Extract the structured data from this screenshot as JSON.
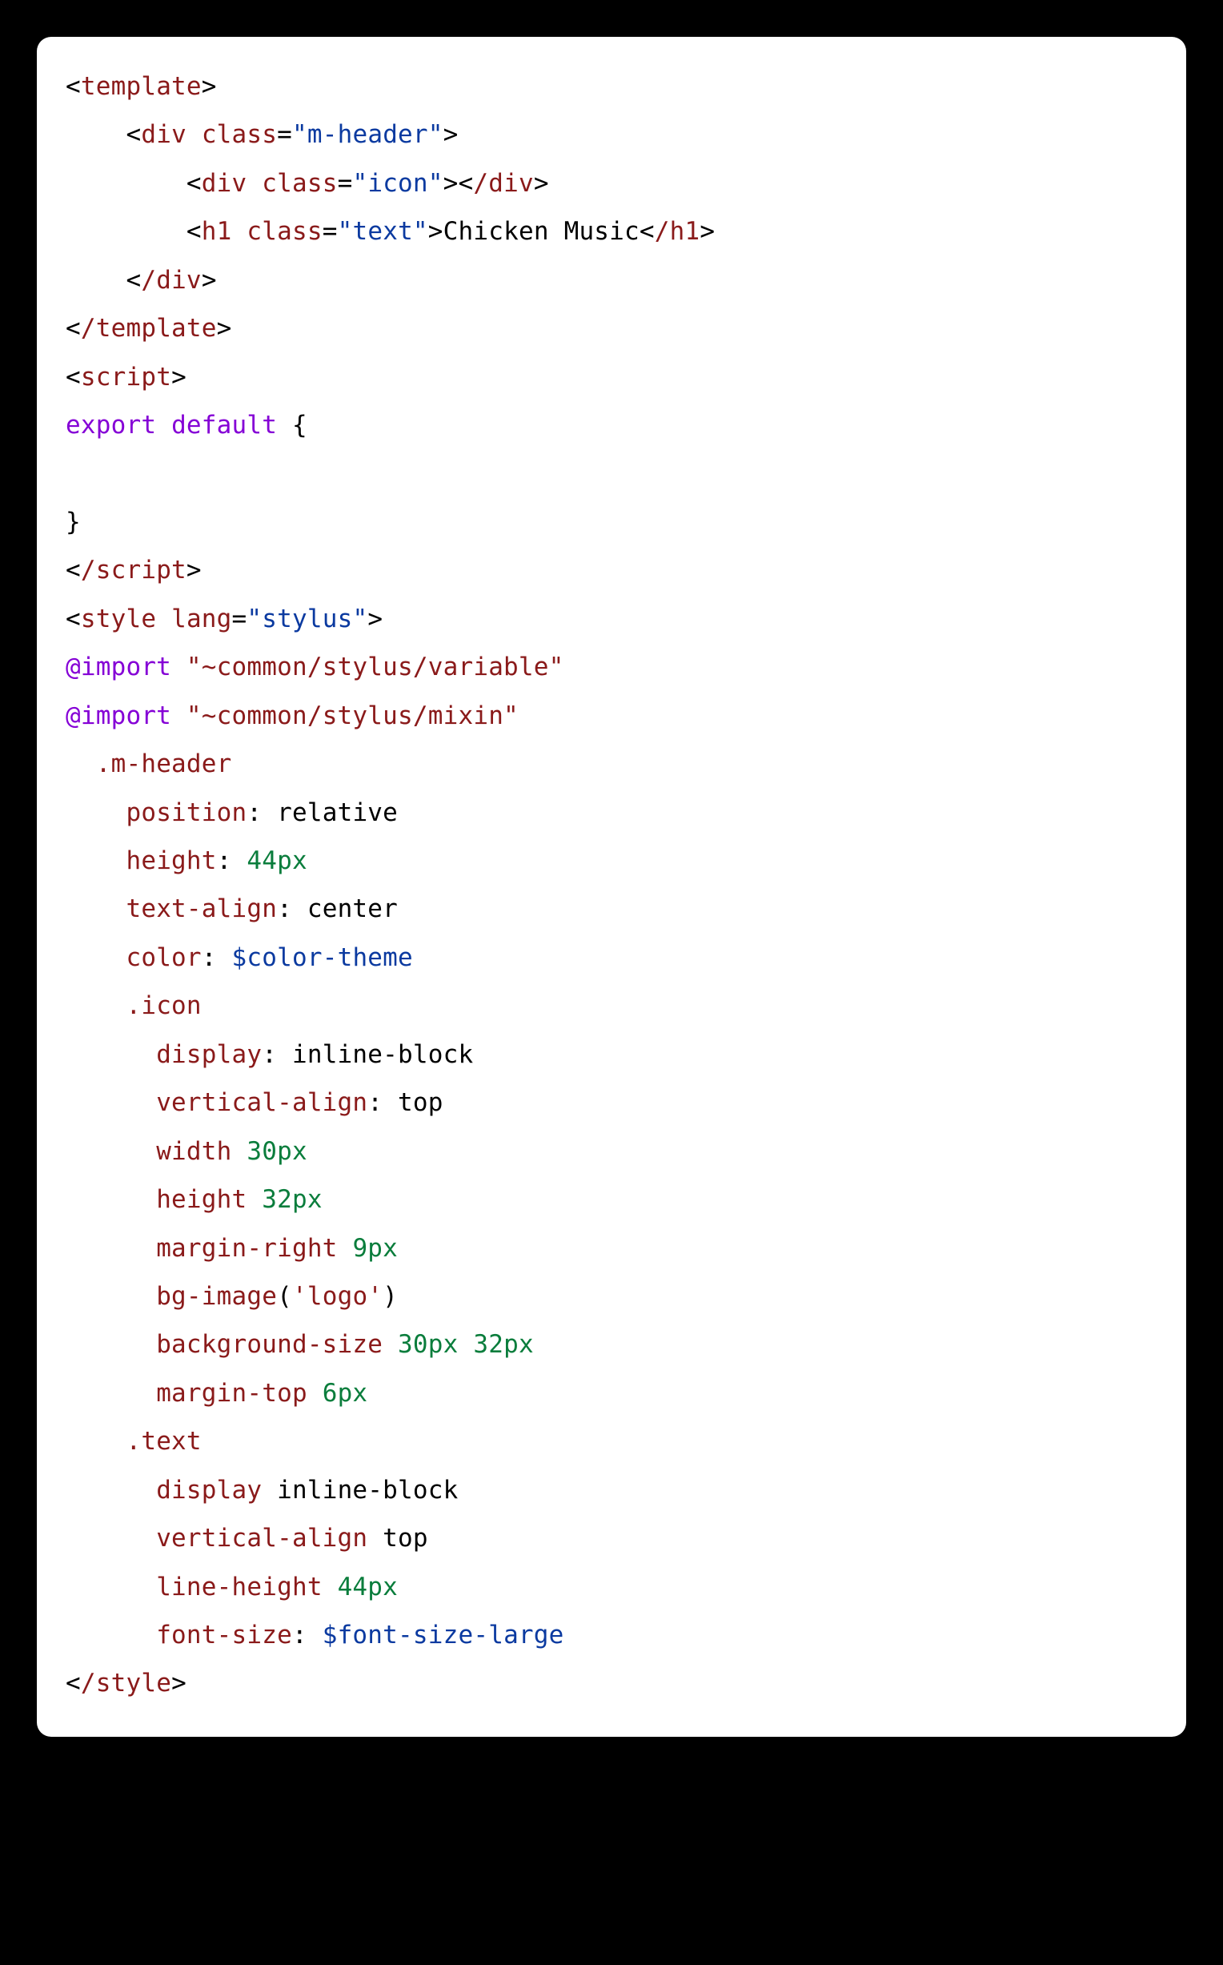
{
  "tokens": [
    {
      "t": "<",
      "c": "t-black"
    },
    {
      "t": "template",
      "c": "t-maroon"
    },
    {
      "t": ">",
      "c": "t-black"
    },
    {
      "t": "\n",
      "c": ""
    },
    {
      "t": "    ",
      "c": ""
    },
    {
      "t": "<",
      "c": "t-black"
    },
    {
      "t": "div",
      "c": "t-maroon"
    },
    {
      "t": " ",
      "c": ""
    },
    {
      "t": "class",
      "c": "t-maroon"
    },
    {
      "t": "=",
      "c": "t-black"
    },
    {
      "t": "\"m-header\"",
      "c": "t-blue"
    },
    {
      "t": ">",
      "c": "t-black"
    },
    {
      "t": "\n",
      "c": ""
    },
    {
      "t": "        ",
      "c": ""
    },
    {
      "t": "<",
      "c": "t-black"
    },
    {
      "t": "div",
      "c": "t-maroon"
    },
    {
      "t": " ",
      "c": ""
    },
    {
      "t": "class",
      "c": "t-maroon"
    },
    {
      "t": "=",
      "c": "t-black"
    },
    {
      "t": "\"icon\"",
      "c": "t-blue"
    },
    {
      "t": ">",
      "c": "t-black"
    },
    {
      "t": "<",
      "c": "t-black"
    },
    {
      "t": "/div",
      "c": "t-maroon"
    },
    {
      "t": ">",
      "c": "t-black"
    },
    {
      "t": "\n",
      "c": ""
    },
    {
      "t": "        ",
      "c": ""
    },
    {
      "t": "<",
      "c": "t-black"
    },
    {
      "t": "h1",
      "c": "t-maroon"
    },
    {
      "t": " ",
      "c": ""
    },
    {
      "t": "class",
      "c": "t-maroon"
    },
    {
      "t": "=",
      "c": "t-black"
    },
    {
      "t": "\"text\"",
      "c": "t-blue"
    },
    {
      "t": ">",
      "c": "t-black"
    },
    {
      "t": "Chicken Music",
      "c": "t-black"
    },
    {
      "t": "<",
      "c": "t-black"
    },
    {
      "t": "/h1",
      "c": "t-maroon"
    },
    {
      "t": ">",
      "c": "t-black"
    },
    {
      "t": "\n",
      "c": ""
    },
    {
      "t": "    ",
      "c": ""
    },
    {
      "t": "<",
      "c": "t-black"
    },
    {
      "t": "/div",
      "c": "t-maroon"
    },
    {
      "t": ">",
      "c": "t-black"
    },
    {
      "t": "\n",
      "c": ""
    },
    {
      "t": "<",
      "c": "t-black"
    },
    {
      "t": "/template",
      "c": "t-maroon"
    },
    {
      "t": ">",
      "c": "t-black"
    },
    {
      "t": "\n",
      "c": ""
    },
    {
      "t": "<",
      "c": "t-black"
    },
    {
      "t": "script",
      "c": "t-maroon"
    },
    {
      "t": ">",
      "c": "t-black"
    },
    {
      "t": "\n",
      "c": ""
    },
    {
      "t": "export",
      "c": "t-purple"
    },
    {
      "t": " ",
      "c": ""
    },
    {
      "t": "default",
      "c": "t-purple"
    },
    {
      "t": " {",
      "c": "t-black"
    },
    {
      "t": "\n",
      "c": ""
    },
    {
      "t": "\n",
      "c": ""
    },
    {
      "t": "}",
      "c": "t-black"
    },
    {
      "t": "\n",
      "c": ""
    },
    {
      "t": "<",
      "c": "t-black"
    },
    {
      "t": "/script",
      "c": "t-maroon"
    },
    {
      "t": ">",
      "c": "t-black"
    },
    {
      "t": "\n",
      "c": ""
    },
    {
      "t": "<",
      "c": "t-black"
    },
    {
      "t": "style",
      "c": "t-maroon"
    },
    {
      "t": " ",
      "c": ""
    },
    {
      "t": "lang",
      "c": "t-maroon"
    },
    {
      "t": "=",
      "c": "t-black"
    },
    {
      "t": "\"stylus\"",
      "c": "t-blue"
    },
    {
      "t": ">",
      "c": "t-black"
    },
    {
      "t": "\n",
      "c": ""
    },
    {
      "t": "@import",
      "c": "t-purple"
    },
    {
      "t": " ",
      "c": ""
    },
    {
      "t": "\"~common/stylus/variable\"",
      "c": "t-maroon"
    },
    {
      "t": "\n",
      "c": ""
    },
    {
      "t": "@import",
      "c": "t-purple"
    },
    {
      "t": " ",
      "c": ""
    },
    {
      "t": "\"~common/stylus/mixin\"",
      "c": "t-maroon"
    },
    {
      "t": "\n",
      "c": ""
    },
    {
      "t": "  ",
      "c": ""
    },
    {
      "t": ".m-header",
      "c": "t-maroon"
    },
    {
      "t": "\n",
      "c": ""
    },
    {
      "t": "    ",
      "c": ""
    },
    {
      "t": "position",
      "c": "t-maroon"
    },
    {
      "t": ": ",
      "c": "t-black"
    },
    {
      "t": "relative",
      "c": "t-black"
    },
    {
      "t": "\n",
      "c": ""
    },
    {
      "t": "    ",
      "c": ""
    },
    {
      "t": "height",
      "c": "t-maroon"
    },
    {
      "t": ": ",
      "c": "t-black"
    },
    {
      "t": "44px",
      "c": "t-green"
    },
    {
      "t": "\n",
      "c": ""
    },
    {
      "t": "    ",
      "c": ""
    },
    {
      "t": "text-align",
      "c": "t-maroon"
    },
    {
      "t": ": ",
      "c": "t-black"
    },
    {
      "t": "center",
      "c": "t-black"
    },
    {
      "t": "\n",
      "c": ""
    },
    {
      "t": "    ",
      "c": ""
    },
    {
      "t": "color",
      "c": "t-maroon"
    },
    {
      "t": ": ",
      "c": "t-black"
    },
    {
      "t": "$color-theme",
      "c": "t-blue"
    },
    {
      "t": "\n",
      "c": ""
    },
    {
      "t": "    ",
      "c": ""
    },
    {
      "t": ".icon",
      "c": "t-maroon"
    },
    {
      "t": "\n",
      "c": ""
    },
    {
      "t": "      ",
      "c": ""
    },
    {
      "t": "display",
      "c": "t-maroon"
    },
    {
      "t": ": ",
      "c": "t-black"
    },
    {
      "t": "inline-block",
      "c": "t-black"
    },
    {
      "t": "\n",
      "c": ""
    },
    {
      "t": "      ",
      "c": ""
    },
    {
      "t": "vertical-align",
      "c": "t-maroon"
    },
    {
      "t": ": ",
      "c": "t-black"
    },
    {
      "t": "top",
      "c": "t-black"
    },
    {
      "t": "\n",
      "c": ""
    },
    {
      "t": "      ",
      "c": ""
    },
    {
      "t": "width",
      "c": "t-maroon"
    },
    {
      "t": " ",
      "c": ""
    },
    {
      "t": "30px",
      "c": "t-green"
    },
    {
      "t": "\n",
      "c": ""
    },
    {
      "t": "      ",
      "c": ""
    },
    {
      "t": "height",
      "c": "t-maroon"
    },
    {
      "t": " ",
      "c": ""
    },
    {
      "t": "32px",
      "c": "t-green"
    },
    {
      "t": "\n",
      "c": ""
    },
    {
      "t": "      ",
      "c": ""
    },
    {
      "t": "margin-right",
      "c": "t-maroon"
    },
    {
      "t": " ",
      "c": ""
    },
    {
      "t": "9px",
      "c": "t-green"
    },
    {
      "t": "\n",
      "c": ""
    },
    {
      "t": "      ",
      "c": ""
    },
    {
      "t": "bg-image",
      "c": "t-maroon"
    },
    {
      "t": "(",
      "c": "t-black"
    },
    {
      "t": "'logo'",
      "c": "t-maroon"
    },
    {
      "t": ")",
      "c": "t-black"
    },
    {
      "t": "\n",
      "c": ""
    },
    {
      "t": "      ",
      "c": ""
    },
    {
      "t": "background-size",
      "c": "t-maroon"
    },
    {
      "t": " ",
      "c": ""
    },
    {
      "t": "30px",
      "c": "t-green"
    },
    {
      "t": " ",
      "c": ""
    },
    {
      "t": "32px",
      "c": "t-green"
    },
    {
      "t": "\n",
      "c": ""
    },
    {
      "t": "      ",
      "c": ""
    },
    {
      "t": "margin-top",
      "c": "t-maroon"
    },
    {
      "t": " ",
      "c": ""
    },
    {
      "t": "6px",
      "c": "t-green"
    },
    {
      "t": "\n",
      "c": ""
    },
    {
      "t": "    ",
      "c": ""
    },
    {
      "t": ".text",
      "c": "t-maroon"
    },
    {
      "t": "\n",
      "c": ""
    },
    {
      "t": "      ",
      "c": ""
    },
    {
      "t": "display",
      "c": "t-maroon"
    },
    {
      "t": " ",
      "c": ""
    },
    {
      "t": "inline-block",
      "c": "t-black"
    },
    {
      "t": "\n",
      "c": ""
    },
    {
      "t": "      ",
      "c": ""
    },
    {
      "t": "vertical-align",
      "c": "t-maroon"
    },
    {
      "t": " ",
      "c": ""
    },
    {
      "t": "top",
      "c": "t-black"
    },
    {
      "t": "\n",
      "c": ""
    },
    {
      "t": "      ",
      "c": ""
    },
    {
      "t": "line-height",
      "c": "t-maroon"
    },
    {
      "t": " ",
      "c": ""
    },
    {
      "t": "44px",
      "c": "t-green"
    },
    {
      "t": "\n",
      "c": ""
    },
    {
      "t": "      ",
      "c": ""
    },
    {
      "t": "font-size",
      "c": "t-maroon"
    },
    {
      "t": ": ",
      "c": "t-black"
    },
    {
      "t": "$font-size-large",
      "c": "t-blue"
    },
    {
      "t": "\n",
      "c": ""
    },
    {
      "t": "<",
      "c": "t-black"
    },
    {
      "t": "/style",
      "c": "t-maroon"
    },
    {
      "t": ">",
      "c": "t-black"
    }
  ]
}
